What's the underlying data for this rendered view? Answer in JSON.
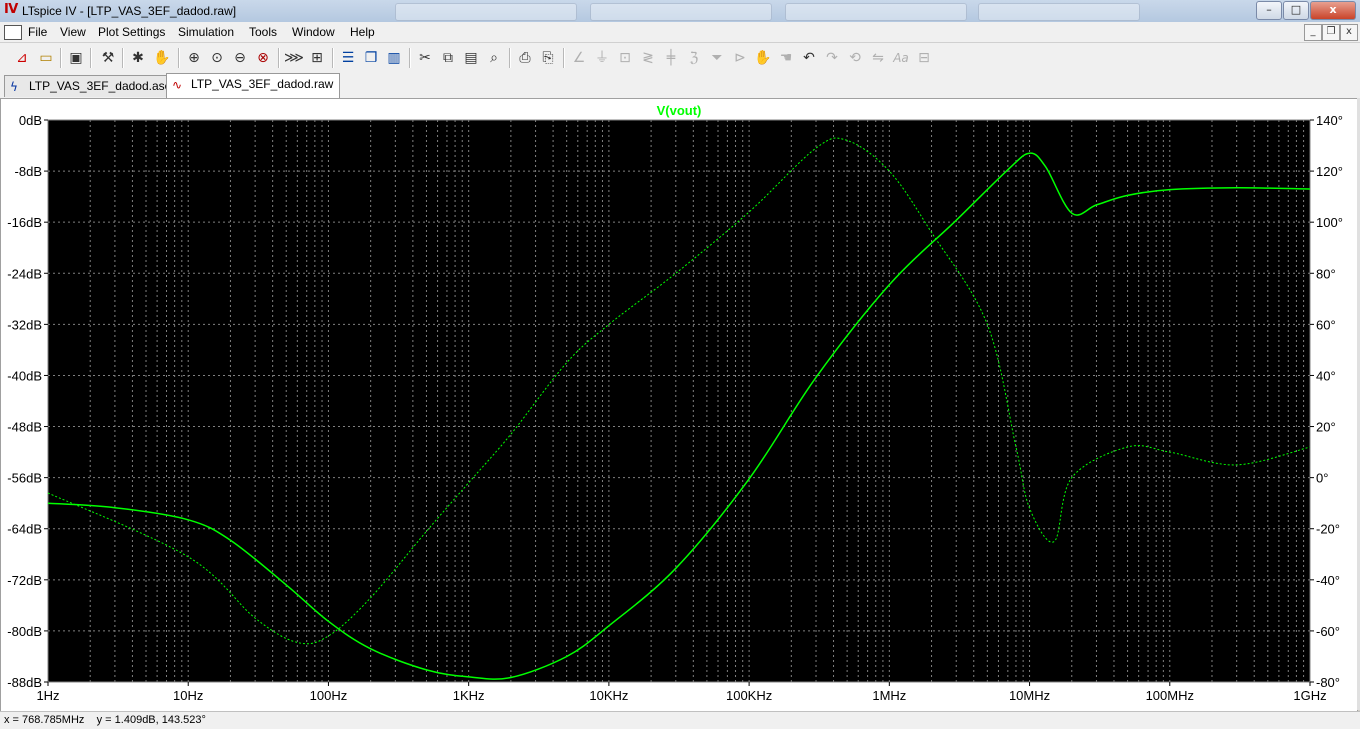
{
  "window": {
    "title": "LTspice IV - [LTP_VAS_3EF_dadod.raw]",
    "controls": {
      "minimize": "–",
      "maximize": "□",
      "close": "x"
    },
    "mdi_controls": {
      "minimize": "_",
      "restore": "❐",
      "close": "x"
    }
  },
  "menu": {
    "items": [
      "File",
      "View",
      "Plot Settings",
      "Simulation",
      "Tools",
      "Window",
      "Help"
    ]
  },
  "toolbar": {
    "icons": [
      "new-schematic-icon",
      "open-icon",
      "save-icon",
      "control-panel-icon",
      "run-icon",
      "halt-icon",
      "zoom-in-icon",
      "zoom-area-icon",
      "zoom-out-icon",
      "zoom-fit-icon",
      "autorange-icon",
      "grid-icon",
      "tile-horizontal-icon",
      "cascade-icon",
      "tile-vertical-icon",
      "cut-icon",
      "copy-icon",
      "paste-icon",
      "find-icon",
      "print-preview-icon",
      "print-icon",
      "wire-icon",
      "ground-icon",
      "label-icon",
      "resistor-icon",
      "capacitor-icon",
      "inductor-icon",
      "diode-icon",
      "component-icon",
      "move-icon",
      "drag-icon",
      "undo-icon",
      "redo-icon",
      "rotate-icon",
      "mirror-icon",
      "text-icon",
      "spice-directive-icon"
    ]
  },
  "tabs": [
    {
      "label": "LTP_VAS_3EF_dadod.asc",
      "icon": "schematic-icon",
      "active": false
    },
    {
      "label": "LTP_VAS_3EF_dadod.raw",
      "icon": "waveform-icon",
      "active": true
    }
  ],
  "status": {
    "text": "x = 768.785MHz    y = 1.409dB, 143.523°"
  },
  "colors": {
    "plot_background": "#000000",
    "trace": "#00ff00",
    "grid": "#808080",
    "axis_text": "#000000"
  },
  "chart_data": {
    "type": "line",
    "title": "V(vout)",
    "x_scale": "log",
    "xlim": [
      1,
      1000000000
    ],
    "x_ticks": [
      {
        "v": 1,
        "label": "1Hz"
      },
      {
        "v": 10,
        "label": "10Hz"
      },
      {
        "v": 100,
        "label": "100Hz"
      },
      {
        "v": 1000,
        "label": "1KHz"
      },
      {
        "v": 10000,
        "label": "10KHz"
      },
      {
        "v": 100000,
        "label": "100KHz"
      },
      {
        "v": 1000000,
        "label": "1MHz"
      },
      {
        "v": 10000000,
        "label": "10MHz"
      },
      {
        "v": 100000000,
        "label": "100MHz"
      },
      {
        "v": 1000000000,
        "label": "1GHz"
      }
    ],
    "y_left": {
      "unit": "dB",
      "range": [
        -88,
        0
      ],
      "ticks": [
        {
          "v": 0,
          "label": "0dB"
        },
        {
          "v": -8,
          "label": "-8dB"
        },
        {
          "v": -16,
          "label": "-16dB"
        },
        {
          "v": -24,
          "label": "-24dB"
        },
        {
          "v": -32,
          "label": "-32dB"
        },
        {
          "v": -40,
          "label": "-40dB"
        },
        {
          "v": -48,
          "label": "-48dB"
        },
        {
          "v": -56,
          "label": "-56dB"
        },
        {
          "v": -64,
          "label": "-64dB"
        },
        {
          "v": -72,
          "label": "-72dB"
        },
        {
          "v": -80,
          "label": "-80dB"
        },
        {
          "v": -88,
          "label": "-88dB"
        }
      ]
    },
    "y_right": {
      "unit": "degrees",
      "range": [
        -80,
        140
      ],
      "ticks": [
        {
          "v": 140,
          "label": "140°"
        },
        {
          "v": 120,
          "label": "120°"
        },
        {
          "v": 100,
          "label": "100°"
        },
        {
          "v": 80,
          "label": "80°"
        },
        {
          "v": 60,
          "label": "60°"
        },
        {
          "v": 40,
          "label": "40°"
        },
        {
          "v": 20,
          "label": "20°"
        },
        {
          "v": 0,
          "label": "0°"
        },
        {
          "v": -20,
          "label": "-20°"
        },
        {
          "v": -40,
          "label": "-40°"
        },
        {
          "v": -60,
          "label": "-60°"
        },
        {
          "v": -80,
          "label": "-80°"
        }
      ]
    },
    "grid": true,
    "series": [
      {
        "name": "V(vout)",
        "quantity": "magnitude",
        "axis": "left",
        "style": "solid",
        "points": [
          [
            1,
            -60.0
          ],
          [
            3,
            -60.7
          ],
          [
            10,
            -62.6
          ],
          [
            20,
            -65.8
          ],
          [
            50,
            -72.8
          ],
          [
            100,
            -78.5
          ],
          [
            200,
            -82.8
          ],
          [
            500,
            -86.1
          ],
          [
            1000,
            -87.2
          ],
          [
            2000,
            -87.3
          ],
          [
            5000,
            -84.0
          ],
          [
            10000,
            -79.2
          ],
          [
            30000,
            -70.2
          ],
          [
            100000,
            -56.2
          ],
          [
            300000,
            -40.3
          ],
          [
            1000000,
            -25.8
          ],
          [
            3000000,
            -15.7
          ],
          [
            7000000,
            -7.8
          ],
          [
            10000000,
            -5.2
          ],
          [
            13000000,
            -7.3
          ],
          [
            20000000,
            -14.6
          ],
          [
            30000000,
            -13.3
          ],
          [
            50000000,
            -11.8
          ],
          [
            100000000,
            -10.9
          ],
          [
            300000000,
            -10.6
          ],
          [
            1000000000,
            -10.8
          ]
        ]
      },
      {
        "name": "V(vout)",
        "quantity": "phase",
        "axis": "right",
        "style": "dotted",
        "points": [
          [
            1,
            -6
          ],
          [
            10,
            -31
          ],
          [
            30,
            -55
          ],
          [
            60,
            -64.5
          ],
          [
            100,
            -62
          ],
          [
            200,
            -47
          ],
          [
            500,
            -21
          ],
          [
            1000,
            -2
          ],
          [
            2000,
            17
          ],
          [
            5000,
            45
          ],
          [
            10000,
            60
          ],
          [
            30000,
            80
          ],
          [
            100000,
            104
          ],
          [
            300000,
            129
          ],
          [
            500000,
            132
          ],
          [
            1000000,
            120
          ],
          [
            2000000,
            96
          ],
          [
            5000000,
            60
          ],
          [
            8000000,
            12
          ],
          [
            10000000,
            -12
          ],
          [
            15000000,
            -25
          ],
          [
            20000000,
            0
          ],
          [
            50000000,
            12
          ],
          [
            100000000,
            10
          ],
          [
            300000000,
            5
          ],
          [
            1000000000,
            12
          ]
        ]
      }
    ]
  }
}
